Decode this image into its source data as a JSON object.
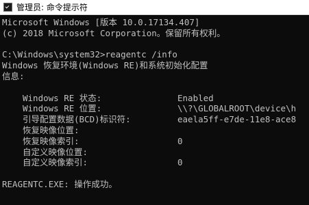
{
  "window": {
    "title": "管理员: 命令提示符",
    "icon": "cmd-icon",
    "colors": {
      "background": "#0c0c0c",
      "text": "#c0c0c0",
      "titlebar": "#ffffff"
    }
  },
  "console": {
    "banner": [
      "Microsoft Windows [版本 10.0.17134.407]",
      "(c) 2018 Microsoft Corporation。保留所有权利。"
    ],
    "prompt_line": "C:\\Windows\\system32>reagentc /info",
    "header": [
      "Windows 恢复环境(Windows RE)和系统初始化配置",
      "信息:"
    ],
    "info_rows": [
      {
        "label": "Windows RE 状态:",
        "value": "Enabled"
      },
      {
        "label": "Windows RE 位置:",
        "value": "\\\\?\\GLOBALROOT\\device\\h"
      },
      {
        "label": "引导配置数据(BCD)标识符:",
        "value": "eaela5ff-e7de-11e8-ace8"
      },
      {
        "label": "恢复映像位置:",
        "value": ""
      },
      {
        "label": "恢复映像索引:",
        "value": "0"
      },
      {
        "label": "自定义映像位置:",
        "value": ""
      },
      {
        "label": "自定义映像索引:",
        "value": "0"
      }
    ],
    "result": "REAGENTC.EXE: 操作成功。"
  }
}
